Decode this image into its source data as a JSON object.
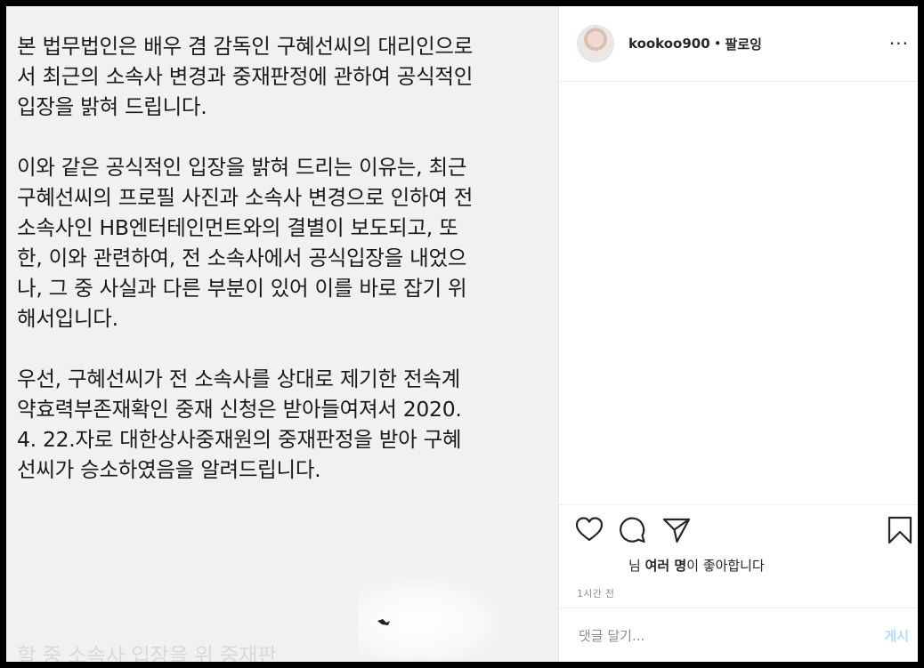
{
  "post": {
    "paragraphs": [
      [
        "본 법무법인은 배우 겸 감독인 구혜선씨의 대리인으로",
        "서 최근의 소속사 변경과 중재판정에 관하여 공식적인",
        "입장을 밝혀 드립니다."
      ],
      [
        "이와 같은 공식적인 입장을 밝혀 드리는 이유는, 최근",
        "구혜선씨의 프로필 사진과 소속사 변경으로 인하여 전",
        "소속사인 HB엔터테인먼트와의 결별이 보도되고, 또",
        "한, 이와 관련하여, 전 소속사에서 공식입장을 내었으",
        "나, 그 중 사실과 다른 부분이 있어 이를 바로 잡기 위",
        "해서입니다."
      ],
      [
        "우선, 구혜선씨가 전 소속사를 상대로 제기한 전속계",
        "약효력부존재확인 중재 신청은 받아들여져서 2020.",
        "4. 22.자로 대한상사중재원의 중재판정을 받아 구혜",
        "선씨가 승소하였음을 알려드립니다."
      ]
    ],
    "faded_line": "할 중 소속사 입장을 위 중재판"
  },
  "header": {
    "username": "kookoo900",
    "separator": "•",
    "follow_label": "팔로잉",
    "more_label": "···"
  },
  "likes": {
    "prefix": "님 ",
    "bold": "여러 명",
    "suffix": "이 좋아합니다"
  },
  "time_ago": "1시간 전",
  "comment": {
    "placeholder": "댓글 달기...",
    "post_label": "게시"
  },
  "colors": {
    "text": "#262626",
    "muted": "#8e8e8e",
    "post_disabled": "#b2dffc",
    "frame": "#000000"
  },
  "icons": [
    "heart-icon",
    "comment-icon",
    "share-icon",
    "bookmark-icon",
    "more-icon"
  ]
}
